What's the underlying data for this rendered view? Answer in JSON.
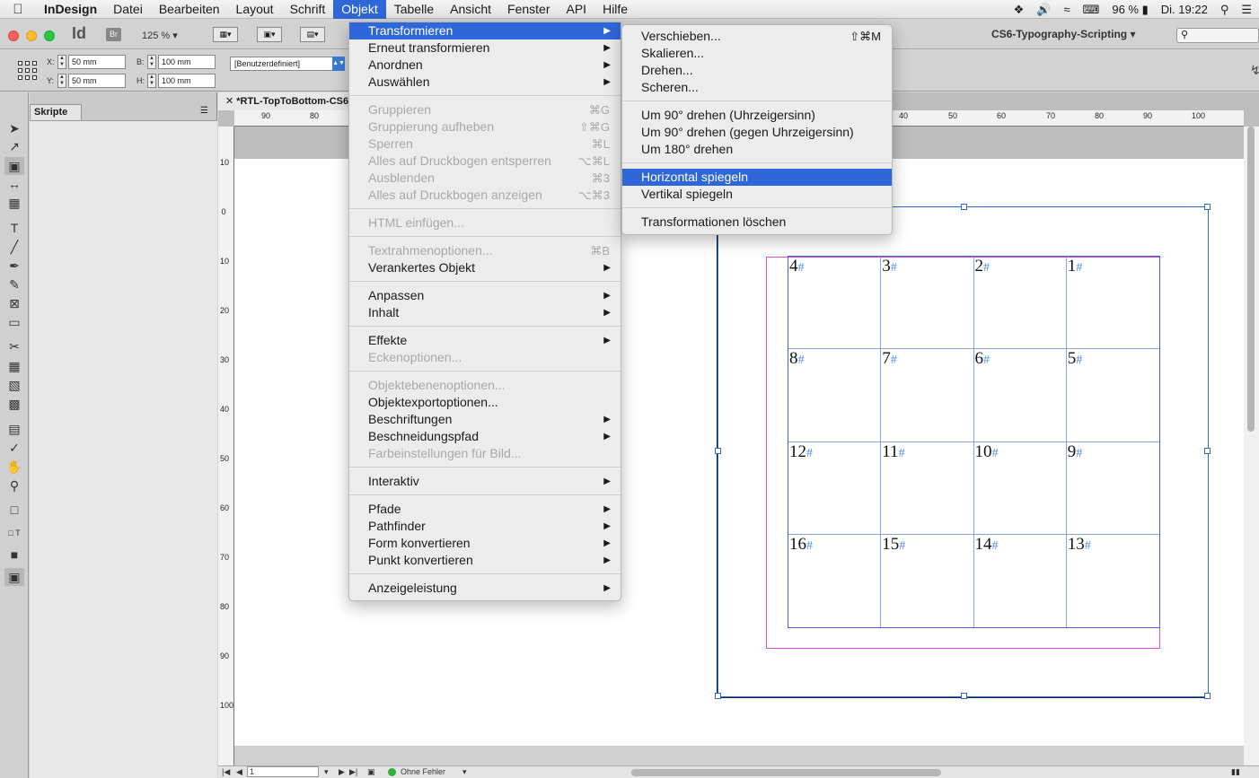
{
  "menubar": {
    "apple": "",
    "items": [
      "InDesign",
      "Datei",
      "Bearbeiten",
      "Layout",
      "Schrift",
      "Objekt",
      "Tabelle",
      "Ansicht",
      "Fenster",
      "API",
      "Hilfe"
    ],
    "battery": "96 %",
    "clock": "Di. 19:22"
  },
  "appbar": {
    "logo": "Id",
    "bridge": "Br",
    "zoom": "125 %",
    "workspace": "CS6-Typography-Scripting"
  },
  "control": {
    "x_label": "X:",
    "x_value": "50 mm",
    "y_label": "Y:",
    "y_value": "50 mm",
    "w_label": "B:",
    "w_value": "100 mm",
    "h_label": "H:",
    "h_value": "100 mm",
    "style": "[Benutzerdefiniert]"
  },
  "panel": {
    "tab": "Skripte"
  },
  "document": {
    "tab": "*RTL-TopToBottom-CS6",
    "hruler_left": [
      "90",
      "80"
    ],
    "hruler_right": [
      "40",
      "50",
      "60",
      "70",
      "80",
      "90",
      "100"
    ],
    "vruler": [
      "10",
      "0",
      "10",
      "20",
      "30",
      "40",
      "50",
      "60",
      "70",
      "80",
      "90",
      "100"
    ],
    "cells": [
      "4",
      "3",
      "2",
      "1",
      "8",
      "7",
      "6",
      "5",
      "12",
      "11",
      "10",
      "9",
      "16",
      "15",
      "14",
      "13"
    ],
    "hash": "#"
  },
  "status": {
    "page": "1",
    "preflight": "Ohne Fehler"
  },
  "objekt_menu": [
    {
      "label": "Transformieren",
      "submenu": true,
      "highlight": true
    },
    {
      "label": "Erneut transformieren",
      "submenu": true
    },
    {
      "label": "Anordnen",
      "submenu": true
    },
    {
      "label": "Auswählen",
      "submenu": true
    },
    {
      "sep": true
    },
    {
      "label": "Gruppieren",
      "shortcut": "⌘G",
      "disabled": true
    },
    {
      "label": "Gruppierung aufheben",
      "shortcut": "⇧⌘G",
      "disabled": true
    },
    {
      "label": "Sperren",
      "shortcut": "⌘L",
      "disabled": true
    },
    {
      "label": "Alles auf Druckbogen entsperren",
      "shortcut": "⌥⌘L",
      "disabled": true
    },
    {
      "label": "Ausblenden",
      "shortcut": "⌘3",
      "disabled": true
    },
    {
      "label": "Alles auf Druckbogen anzeigen",
      "shortcut": "⌥⌘3",
      "disabled": true
    },
    {
      "sep": true
    },
    {
      "label": "HTML einfügen...",
      "disabled": true
    },
    {
      "sep": true
    },
    {
      "label": "Textrahmenoptionen...",
      "shortcut": "⌘B",
      "disabled": true
    },
    {
      "label": "Verankertes Objekt",
      "submenu": true
    },
    {
      "sep": true
    },
    {
      "label": "Anpassen",
      "submenu": true
    },
    {
      "label": "Inhalt",
      "submenu": true
    },
    {
      "sep": true
    },
    {
      "label": "Effekte",
      "submenu": true
    },
    {
      "label": "Eckenoptionen...",
      "disabled": true
    },
    {
      "sep": true
    },
    {
      "label": "Objektebenenoptionen...",
      "disabled": true
    },
    {
      "label": "Objektexportoptionen..."
    },
    {
      "label": "Beschriftungen",
      "submenu": true
    },
    {
      "label": "Beschneidungspfad",
      "submenu": true
    },
    {
      "label": "Farbeinstellungen für Bild...",
      "disabled": true
    },
    {
      "sep": true
    },
    {
      "label": "Interaktiv",
      "submenu": true
    },
    {
      "sep": true
    },
    {
      "label": "Pfade",
      "submenu": true
    },
    {
      "label": "Pathfinder",
      "submenu": true
    },
    {
      "label": "Form konvertieren",
      "submenu": true
    },
    {
      "label": "Punkt konvertieren",
      "submenu": true
    },
    {
      "sep": true
    },
    {
      "label": "Anzeigeleistung",
      "submenu": true
    }
  ],
  "transform_submenu": [
    {
      "label": "Verschieben...",
      "shortcut": "⇧⌘M"
    },
    {
      "label": "Skalieren..."
    },
    {
      "label": "Drehen..."
    },
    {
      "label": "Scheren..."
    },
    {
      "sep": true
    },
    {
      "label": "Um 90° drehen (Uhrzeigersinn)"
    },
    {
      "label": "Um 90° drehen (gegen Uhrzeigersinn)"
    },
    {
      "label": "Um 180° drehen"
    },
    {
      "sep": true
    },
    {
      "label": "Horizontal spiegeln",
      "highlight": true
    },
    {
      "label": "Vertikal spiegeln"
    },
    {
      "sep": true
    },
    {
      "label": "Transformationen löschen"
    }
  ],
  "colors": {
    "highlight": "#2e67d8",
    "frame_blue": "#2a6bcd",
    "margin_pink": "#d94fd9"
  }
}
